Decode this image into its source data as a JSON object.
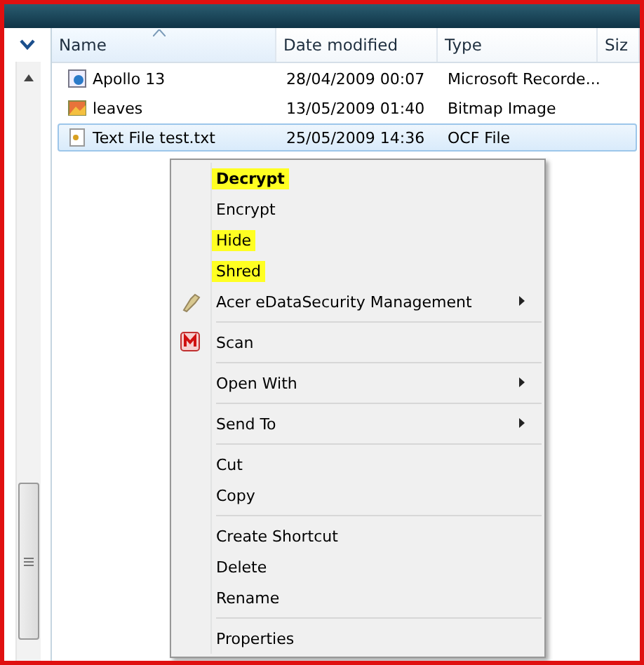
{
  "columns": [
    {
      "label": "Name",
      "sorted": true
    },
    {
      "label": "Date modified",
      "sorted": false
    },
    {
      "label": "Type",
      "sorted": false
    },
    {
      "label": "Siz",
      "sorted": false
    }
  ],
  "files": [
    {
      "name": "Apollo 13",
      "date": "28/04/2009 00:07",
      "type": "Microsoft Recorde...",
      "selected": false
    },
    {
      "name": "leaves",
      "date": "13/05/2009 01:40",
      "type": "Bitmap Image",
      "selected": false
    },
    {
      "name": "Text File test.txt",
      "date": "25/05/2009 14:36",
      "type": "OCF File",
      "selected": true
    }
  ],
  "context_menu": [
    {
      "kind": "item",
      "label": "Decrypt",
      "bold": true,
      "highlighted": true
    },
    {
      "kind": "item",
      "label": "Encrypt",
      "bold": false,
      "highlighted": false
    },
    {
      "kind": "item",
      "label": "Hide",
      "bold": false,
      "highlighted": true
    },
    {
      "kind": "item",
      "label": "Shred",
      "bold": false,
      "highlighted": true
    },
    {
      "kind": "item",
      "label": "Acer eDataSecurity Management",
      "bold": false,
      "highlighted": false,
      "submenu": true
    },
    {
      "kind": "separator"
    },
    {
      "kind": "item",
      "label": "Scan",
      "bold": false,
      "highlighted": false
    },
    {
      "kind": "separator"
    },
    {
      "kind": "item",
      "label": "Open With",
      "bold": false,
      "highlighted": false,
      "submenu": true
    },
    {
      "kind": "separator"
    },
    {
      "kind": "item",
      "label": "Send To",
      "bold": false,
      "highlighted": false,
      "submenu": true
    },
    {
      "kind": "separator"
    },
    {
      "kind": "item",
      "label": "Cut",
      "bold": false,
      "highlighted": false
    },
    {
      "kind": "item",
      "label": "Copy",
      "bold": false,
      "highlighted": false
    },
    {
      "kind": "separator"
    },
    {
      "kind": "item",
      "label": "Create Shortcut",
      "bold": false,
      "highlighted": false
    },
    {
      "kind": "item",
      "label": "Delete",
      "bold": false,
      "highlighted": false
    },
    {
      "kind": "item",
      "label": "Rename",
      "bold": false,
      "highlighted": false
    },
    {
      "kind": "separator"
    },
    {
      "kind": "item",
      "label": "Properties",
      "bold": false,
      "highlighted": false
    }
  ]
}
